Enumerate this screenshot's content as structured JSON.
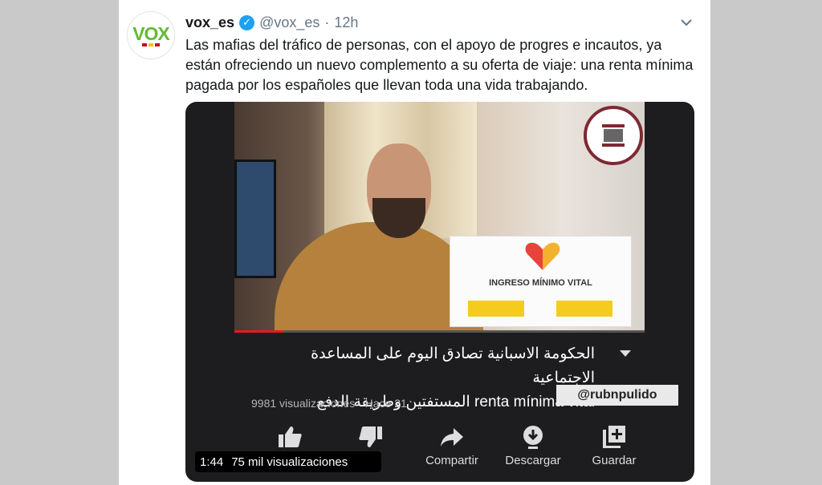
{
  "account": {
    "display_name": "vox_es",
    "handle": "@vox_es",
    "separator": "·",
    "time": "12h",
    "avatar_text": "VOX"
  },
  "tweet": {
    "text": "Las mafias del tráfico de personas, con el apoyo de progres e incautos, ya están ofreciendo un nuevo complemento a su oferta de viaje: una renta mínima pagada por los españoles que llevan toda una vida trabajando."
  },
  "video": {
    "card_heading": "INGRESO MÍNIMO VITAL",
    "title_arabic_line1": "الحكومة الاسبانية تصادق اليوم على المساعدة الاجتماعية",
    "title_arabic_line2": "المستفتين وطريقة الدفع",
    "title_latin": "renta mínima vital",
    "meta": "9981 visualizaciones · Hace 21",
    "watermark": "@rubnpulido",
    "duration": "1:44",
    "views": "75 mil visualizaciones",
    "progress": 0.12
  },
  "actions": {
    "like": "",
    "dislike": "",
    "share": "Compartir",
    "download": "Descargar",
    "save": "Guardar"
  },
  "icons": {
    "verified": "verified-badge-icon",
    "chevron": "chevron-down-icon",
    "like": "thumbs-up-icon",
    "dislike": "thumbs-down-icon",
    "share": "share-arrow-icon",
    "download": "download-icon",
    "save": "add-to-playlist-icon"
  },
  "colors": {
    "vox_green": "#62ba35",
    "verified_blue": "#1da1f2",
    "muted_text": "#657786",
    "progress_red": "#e61b1b"
  }
}
